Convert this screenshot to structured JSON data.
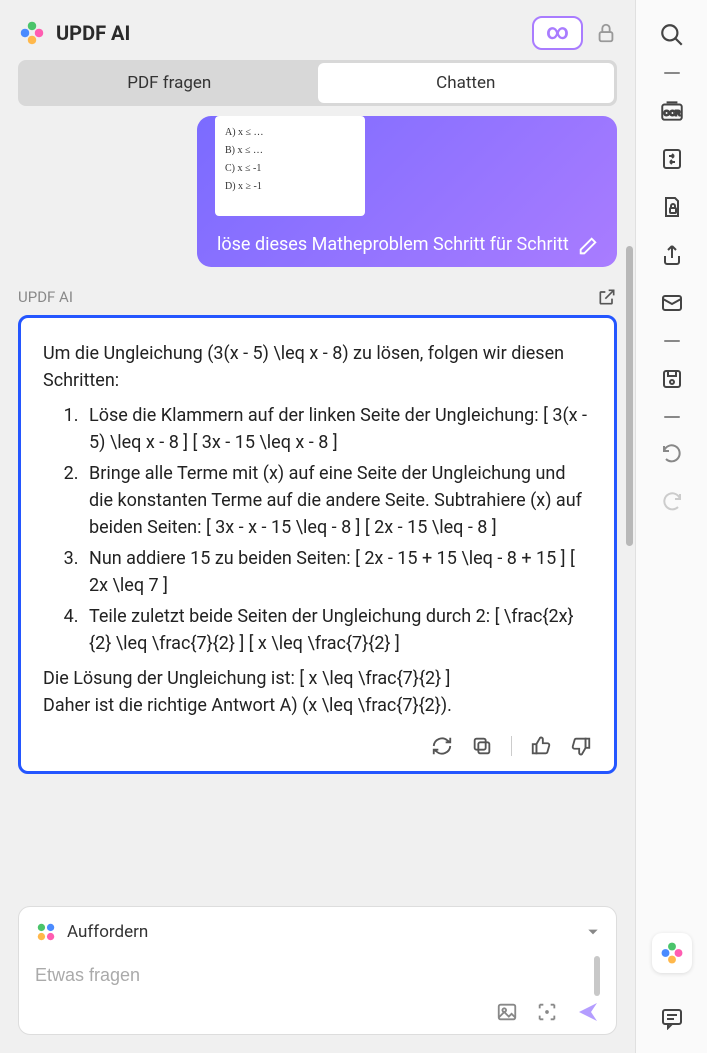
{
  "header": {
    "title": "UPDF AI",
    "infinity_label": "∞"
  },
  "tabs": {
    "ask": "PDF fragen",
    "chat": "Chatten"
  },
  "user_message": {
    "attachment_lines": [
      "A)   x ≤ …",
      "B)   x ≤ …",
      "C)   x ≤ -1",
      "D)   x ≥ -1"
    ],
    "text": "löse dieses Matheproblem Schritt für Schritt"
  },
  "ai_label": "UPDF AI",
  "ai_response": {
    "intro": "Um die Ungleichung (3(x - 5) \\leq x - 8) zu lösen, folgen wir diesen Schritten:",
    "steps": [
      "Löse die Klammern auf der linken Seite der Ungleichung: [ 3(x - 5) \\leq x - 8 ] [ 3x - 15 \\leq x - 8 ]",
      "Bringe alle Terme mit (x) auf eine Seite der Ungleichung und die konstanten Terme auf die andere Seite. Subtrahiere (x) auf beiden Seiten: [ 3x - x - 15 \\leq - 8 ] [ 2x - 15 \\leq - 8 ]",
      "Nun addiere 15 zu beiden Seiten: [ 2x - 15 + 15 \\leq - 8 + 15 ] [ 2x \\leq 7 ]",
      "Teile zuletzt beide Seiten der Ungleichung durch 2: [ \\frac{2x}{2} \\leq \\frac{7}{2} ] [ x \\leq \\frac{7}{2} ]"
    ],
    "solution": "Die Lösung der Ungleichung ist: [ x \\leq \\frac{7}{2} ]",
    "conclusion": "Daher ist die richtige Antwort A) (x \\leq \\frac{7}{2})."
  },
  "input": {
    "prompt_label": "Auffordern",
    "placeholder": "Etwas fragen"
  }
}
